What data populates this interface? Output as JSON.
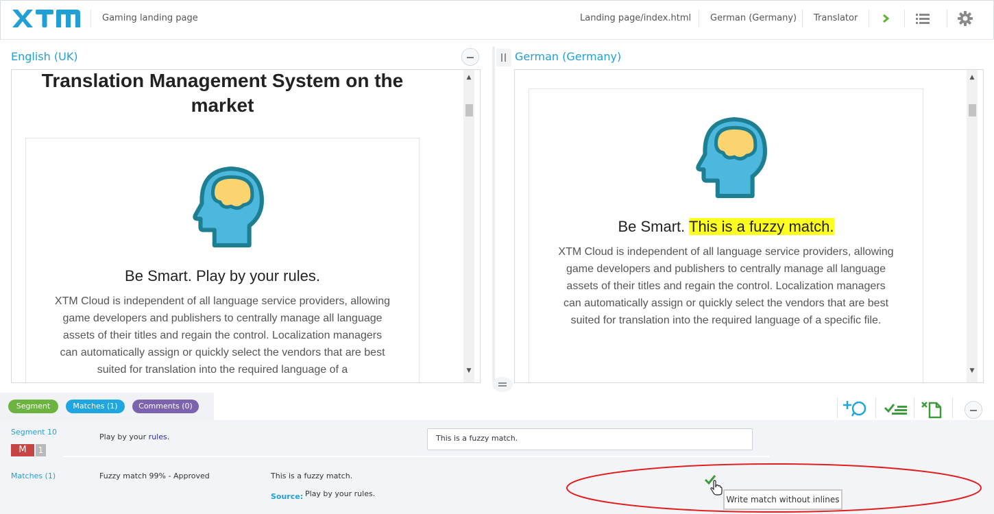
{
  "header": {
    "logo_text": "XTM",
    "project": "Gaming landing page",
    "file": "Landing page/index.html",
    "language": "German (Germany)",
    "role": "Translator"
  },
  "source_pane": {
    "title": "English (UK)",
    "heading": "Translation Management System on the market",
    "subheading": "Be Smart. Play by your rules.",
    "paragraph": "XTM Cloud is independent of all language service providers, allowing game developers and publishers to centrally manage all language assets of their titles and regain the control. Localization managers can automatically assign or quickly select the vendors that are best suited for translation into the required language of a"
  },
  "target_pane": {
    "title": "German (Germany)",
    "subheading_plain": "Be Smart.",
    "subheading_highlight": "This is a fuzzy match.",
    "paragraph": "XTM Cloud is independent of all language service providers, allowing game developers and publishers to centrally manage all language assets of their titles and regain the control. Localization managers can automatically assign or quickly select the vendors that are best suited for translation into the required language of a specific file."
  },
  "tabs": {
    "segment": "Segment",
    "matches": "Matches (1)",
    "comments": "Comments (0)"
  },
  "segment": {
    "label": "Segment 10",
    "source_prefix": "Play by your",
    "source_link": "rules",
    "source_suffix": ".",
    "target_value": "This is a fuzzy match.",
    "badge_m": "M",
    "badge_count": "1"
  },
  "matches": {
    "label": "Matches (1)",
    "type": "Fuzzy match 99% - Approved",
    "text": "This is a fuzzy match.",
    "source_label": "Source:",
    "source_text": "Play by your rules."
  },
  "tooltip": "Write match without inlines",
  "colors": {
    "accent": "#22a0d6",
    "segment_tab": "#6db33f",
    "matches_tab": "#1fa6e0",
    "comments_tab": "#7b63ad",
    "highlight": "#ffff20",
    "annotation": "#e02020"
  }
}
